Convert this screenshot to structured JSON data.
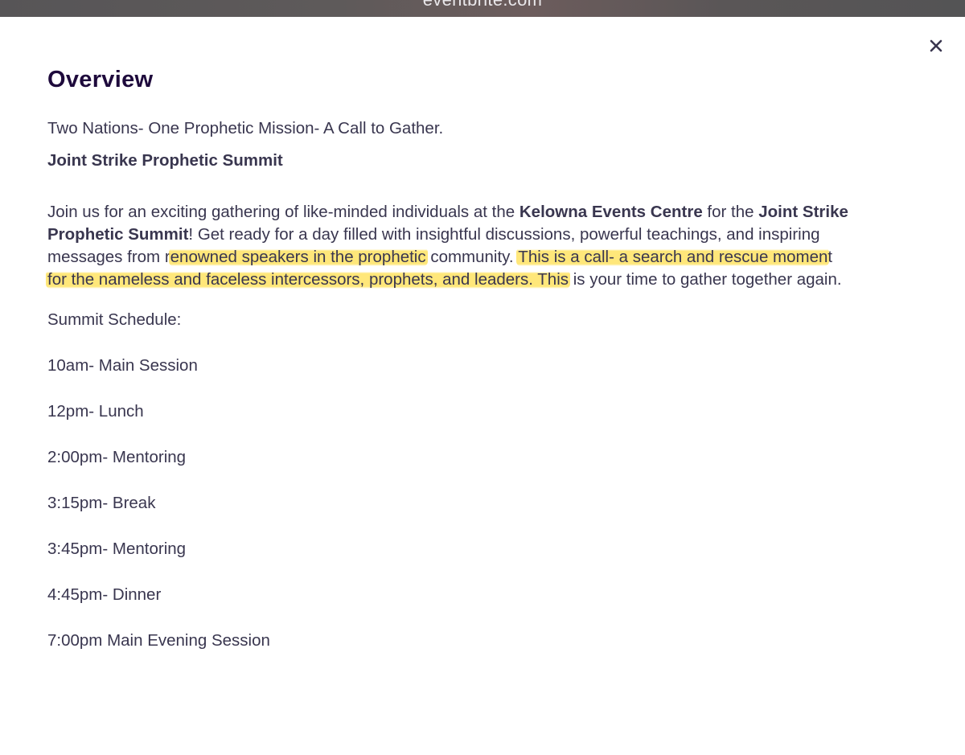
{
  "browser": {
    "url": "eventbrite.com"
  },
  "overview": {
    "title": "Overview",
    "tagline": "Two Nations- One Prophetic Mission- A Call to Gather.",
    "event_name": "Joint Strike Prophetic Summit",
    "description": {
      "l1_a": "Join us for an exciting gathering of like-minded individuals at the ",
      "l1_b": "Kelowna Events Centre",
      "l1_c": " for the ",
      "l1_d": "Joint Strike",
      "l2_a": "Prophetic Summit",
      "l2_b": "! Get ready for a day filled with insightful discussions, powerful teachings, and inspiring",
      "l3_a": "messages from r",
      "l3_b": "enowned speakers in the prophetic",
      "l3_c": " community. ",
      "l3_d": "This is a call- a search and rescue momen",
      "l3_e": "t",
      "l4_a": "for the nameless and faceless intercessors, prophets, and leaders. This",
      "l4_b": " is your time to gather together again."
    },
    "schedule_heading": "Summit Schedule:",
    "schedule": [
      "10am- Main Session",
      "12pm- Lunch",
      "2:00pm- Mentoring",
      "3:15pm- Break",
      "3:45pm- Mentoring",
      "4:45pm- Dinner",
      "7:00pm Main Evening Session"
    ]
  },
  "colors": {
    "title": "#1e0a3c",
    "body_text": "#39364f",
    "highlight": "#ffde46",
    "browser_bar": "#5e5a5a"
  },
  "icons": {
    "close": "close-icon"
  }
}
